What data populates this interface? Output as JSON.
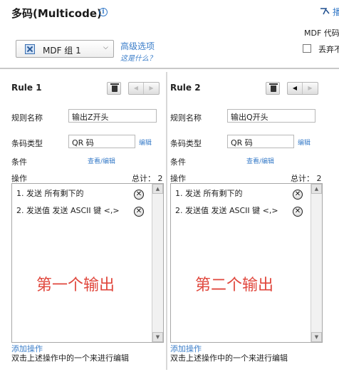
{
  "header": {
    "title": "多码(Multicode)",
    "info_icon": "info-icon",
    "top_right_link": "播",
    "mdf_code_label": "MDF 代码",
    "discard_label": "丢弃不"
  },
  "mdf_select": {
    "icon": "mdf-group-icon",
    "value": "MDF 组 1",
    "chevron": "⌵"
  },
  "advanced": {
    "link": "高级选项",
    "what_link": "这是什么？"
  },
  "labels": {
    "rule_name": "规则名称",
    "barcode_type": "条码类型",
    "condition": "条件",
    "operations": "操作",
    "edit": "编辑",
    "view_edit": "查看/编辑",
    "total": "总计： 2",
    "add_operation": "添加操作",
    "hint": "双击上述操作中的一个来进行编辑",
    "remove": "✕"
  },
  "rules": [
    {
      "title": "Rule 1",
      "name_value": "输出Z开头",
      "type_value": "QR 码",
      "operations": [
        "1. 发送 所有剩下的",
        "2. 发送值 发送 ASCII 键 <,>"
      ],
      "nav_left": "◀",
      "nav_right": "▶",
      "overlay": "第一个输出"
    },
    {
      "title": "Rule 2",
      "name_value": "输出Q开头",
      "type_value": "QR 码",
      "operations": [
        "1. 发送 所有剩下的",
        "2. 发送值 发送 ASCII 键 <,>"
      ],
      "nav_left": "◀",
      "nav_right": "▶",
      "overlay": "第二个输出"
    }
  ],
  "colors": {
    "link": "#3a7dc9",
    "overlay_text": "#e0473d"
  }
}
